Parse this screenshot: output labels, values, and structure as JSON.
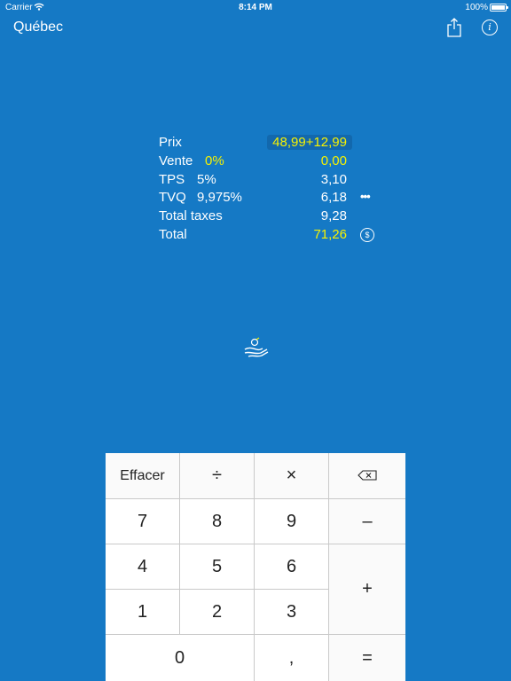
{
  "status_bar": {
    "carrier": "Carrier",
    "time": "8:14 PM",
    "battery": "100%"
  },
  "nav": {
    "title": "Québec",
    "share_icon": "share-icon",
    "info_icon": "info-icon",
    "info_glyph": "i"
  },
  "summary": {
    "price": {
      "label": "Prix",
      "value": "48,99+12,99"
    },
    "sale": {
      "label": "Vente",
      "rate": "0%",
      "value": "0,00"
    },
    "gst": {
      "label": "TPS",
      "rate": "5%",
      "value": "3,10"
    },
    "qst": {
      "label": "TVQ",
      "rate": "9,975%",
      "value": "6,18",
      "more_icon": "ellipsis-icon",
      "more_glyph": "•••"
    },
    "total_taxes": {
      "label": "Total taxes",
      "value": "9,28"
    },
    "total": {
      "label": "Total",
      "value": "71,26",
      "currency_icon": "dollar-icon",
      "currency_glyph": "$"
    }
  },
  "hand_icon": "tip-hand-icon",
  "keypad": {
    "clear": "Effacer",
    "divide": "÷",
    "multiply": "×",
    "backspace_icon": "backspace-icon",
    "seven": "7",
    "eight": "8",
    "nine": "9",
    "minus": "–",
    "four": "4",
    "five": "5",
    "six": "6",
    "plus": "+",
    "one": "1",
    "two": "2",
    "three": "3",
    "zero": "0",
    "comma": ",",
    "equals": "="
  },
  "colors": {
    "background": "#1579c5",
    "highlight": "#f7f200",
    "price_box": "#1268ad",
    "key": "#ffffff",
    "key_separator": "#c9c9c9"
  }
}
